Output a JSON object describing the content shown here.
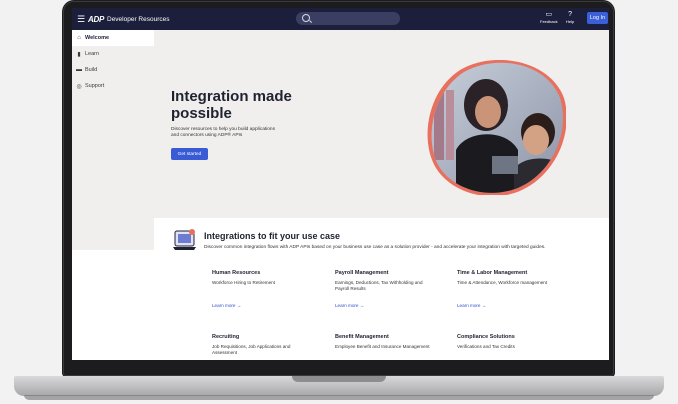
{
  "header": {
    "brand_logo": "ADP",
    "brand_text": "Developer Resources",
    "feedback_label": "Feedback",
    "help_label": "Help",
    "login_label": "Log In",
    "colors": {
      "nav_bg": "#1b1f3b",
      "accent": "#3b5fd6"
    }
  },
  "sidebar": {
    "items": [
      {
        "label": "Welcome",
        "icon": "home-icon",
        "active": true
      },
      {
        "label": "Learn",
        "icon": "book-icon",
        "active": false
      },
      {
        "label": "Build",
        "icon": "folder-icon",
        "active": false
      },
      {
        "label": "Support",
        "icon": "lifebuoy-icon",
        "active": false
      }
    ]
  },
  "hero": {
    "title": "Integration made possible",
    "subtitle": "Discover resources to help you build applications and connectors using ADP® APIs",
    "cta_label": "Get started"
  },
  "integrations": {
    "title": "Integrations to fit your use case",
    "description": "Discover common integration flows with ADP APIs based on your business use case as a solution provider - and accelerate your integration with targeted guides.",
    "cards": [
      {
        "title": "Human Resources",
        "description": "Workforce Hiring to Retirement",
        "link": "Learn more →"
      },
      {
        "title": "Payroll Management",
        "description": "Earnings, Deductions, Tax Withholding and Payroll Results",
        "link": "Learn more →"
      },
      {
        "title": "Time & Labor Management",
        "description": "Time & Attendance, Workforce management",
        "link": "Learn more →"
      },
      {
        "title": "Recruiting",
        "description": "Job Requisitions, Job Applications and Assessment"
      },
      {
        "title": "Benefit Management",
        "description": "Employee Benefit and Insurance Management"
      },
      {
        "title": "Compliance Solutions",
        "description": "Verifications and Tax Credits"
      }
    ]
  }
}
